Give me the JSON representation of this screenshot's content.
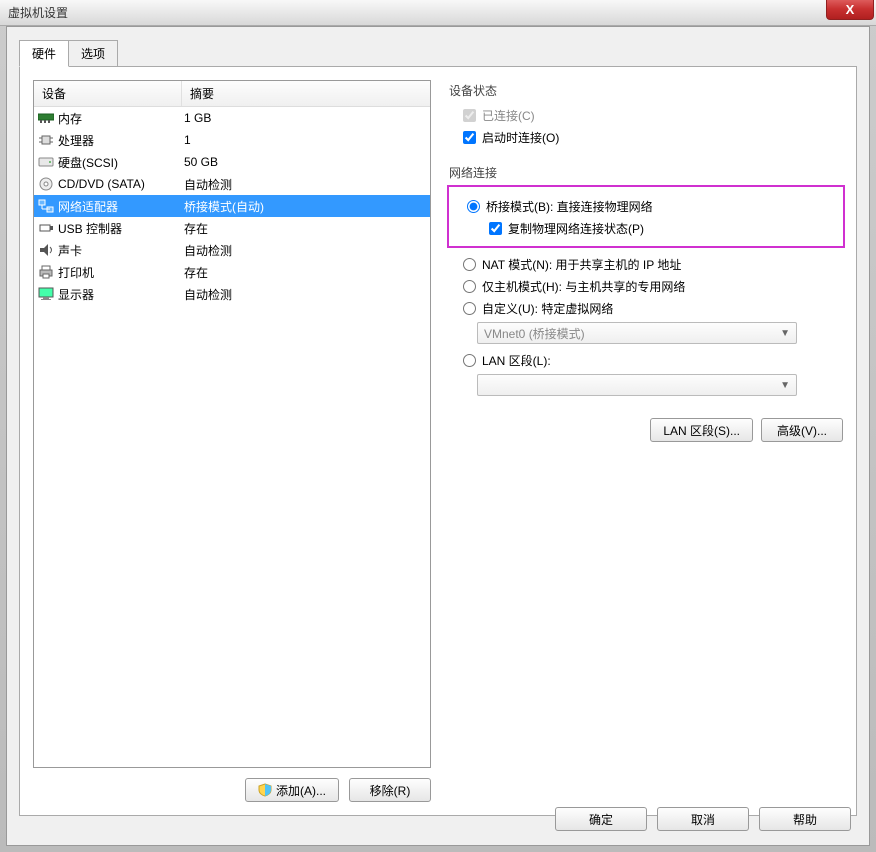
{
  "window": {
    "title": "虚拟机设置",
    "close": "X"
  },
  "tabs": {
    "hardware": "硬件",
    "options": "选项"
  },
  "table": {
    "col_device": "设备",
    "col_summary": "摘要",
    "rows": [
      {
        "device": "内存",
        "summary": "1 GB"
      },
      {
        "device": "处理器",
        "summary": "1"
      },
      {
        "device": "硬盘(SCSI)",
        "summary": "50 GB"
      },
      {
        "device": "CD/DVD (SATA)",
        "summary": "自动检测"
      },
      {
        "device": "网络适配器",
        "summary": "桥接模式(自动)"
      },
      {
        "device": "USB 控制器",
        "summary": "存在"
      },
      {
        "device": "声卡",
        "summary": "自动检测"
      },
      {
        "device": "打印机",
        "summary": "存在"
      },
      {
        "device": "显示器",
        "summary": "自动检测"
      }
    ]
  },
  "left_buttons": {
    "add": "添加(A)...",
    "remove": "移除(R)"
  },
  "device_status": {
    "legend": "设备状态",
    "connected": "已连接(C)",
    "connect_at_power": "启动时连接(O)"
  },
  "network": {
    "legend": "网络连接",
    "bridged": "桥接模式(B): 直接连接物理网络",
    "replicate": "复制物理网络连接状态(P)",
    "nat": "NAT 模式(N): 用于共享主机的 IP 地址",
    "hostonly": "仅主机模式(H): 与主机共享的专用网络",
    "custom": "自定义(U): 特定虚拟网络",
    "custom_combo": "VMnet0 (桥接模式)",
    "lanseg": "LAN 区段(L):",
    "lanseg_combo": "",
    "lan_button": "LAN 区段(S)...",
    "advanced_button": "高级(V)..."
  },
  "footer": {
    "ok": "确定",
    "cancel": "取消",
    "help": "帮助"
  }
}
